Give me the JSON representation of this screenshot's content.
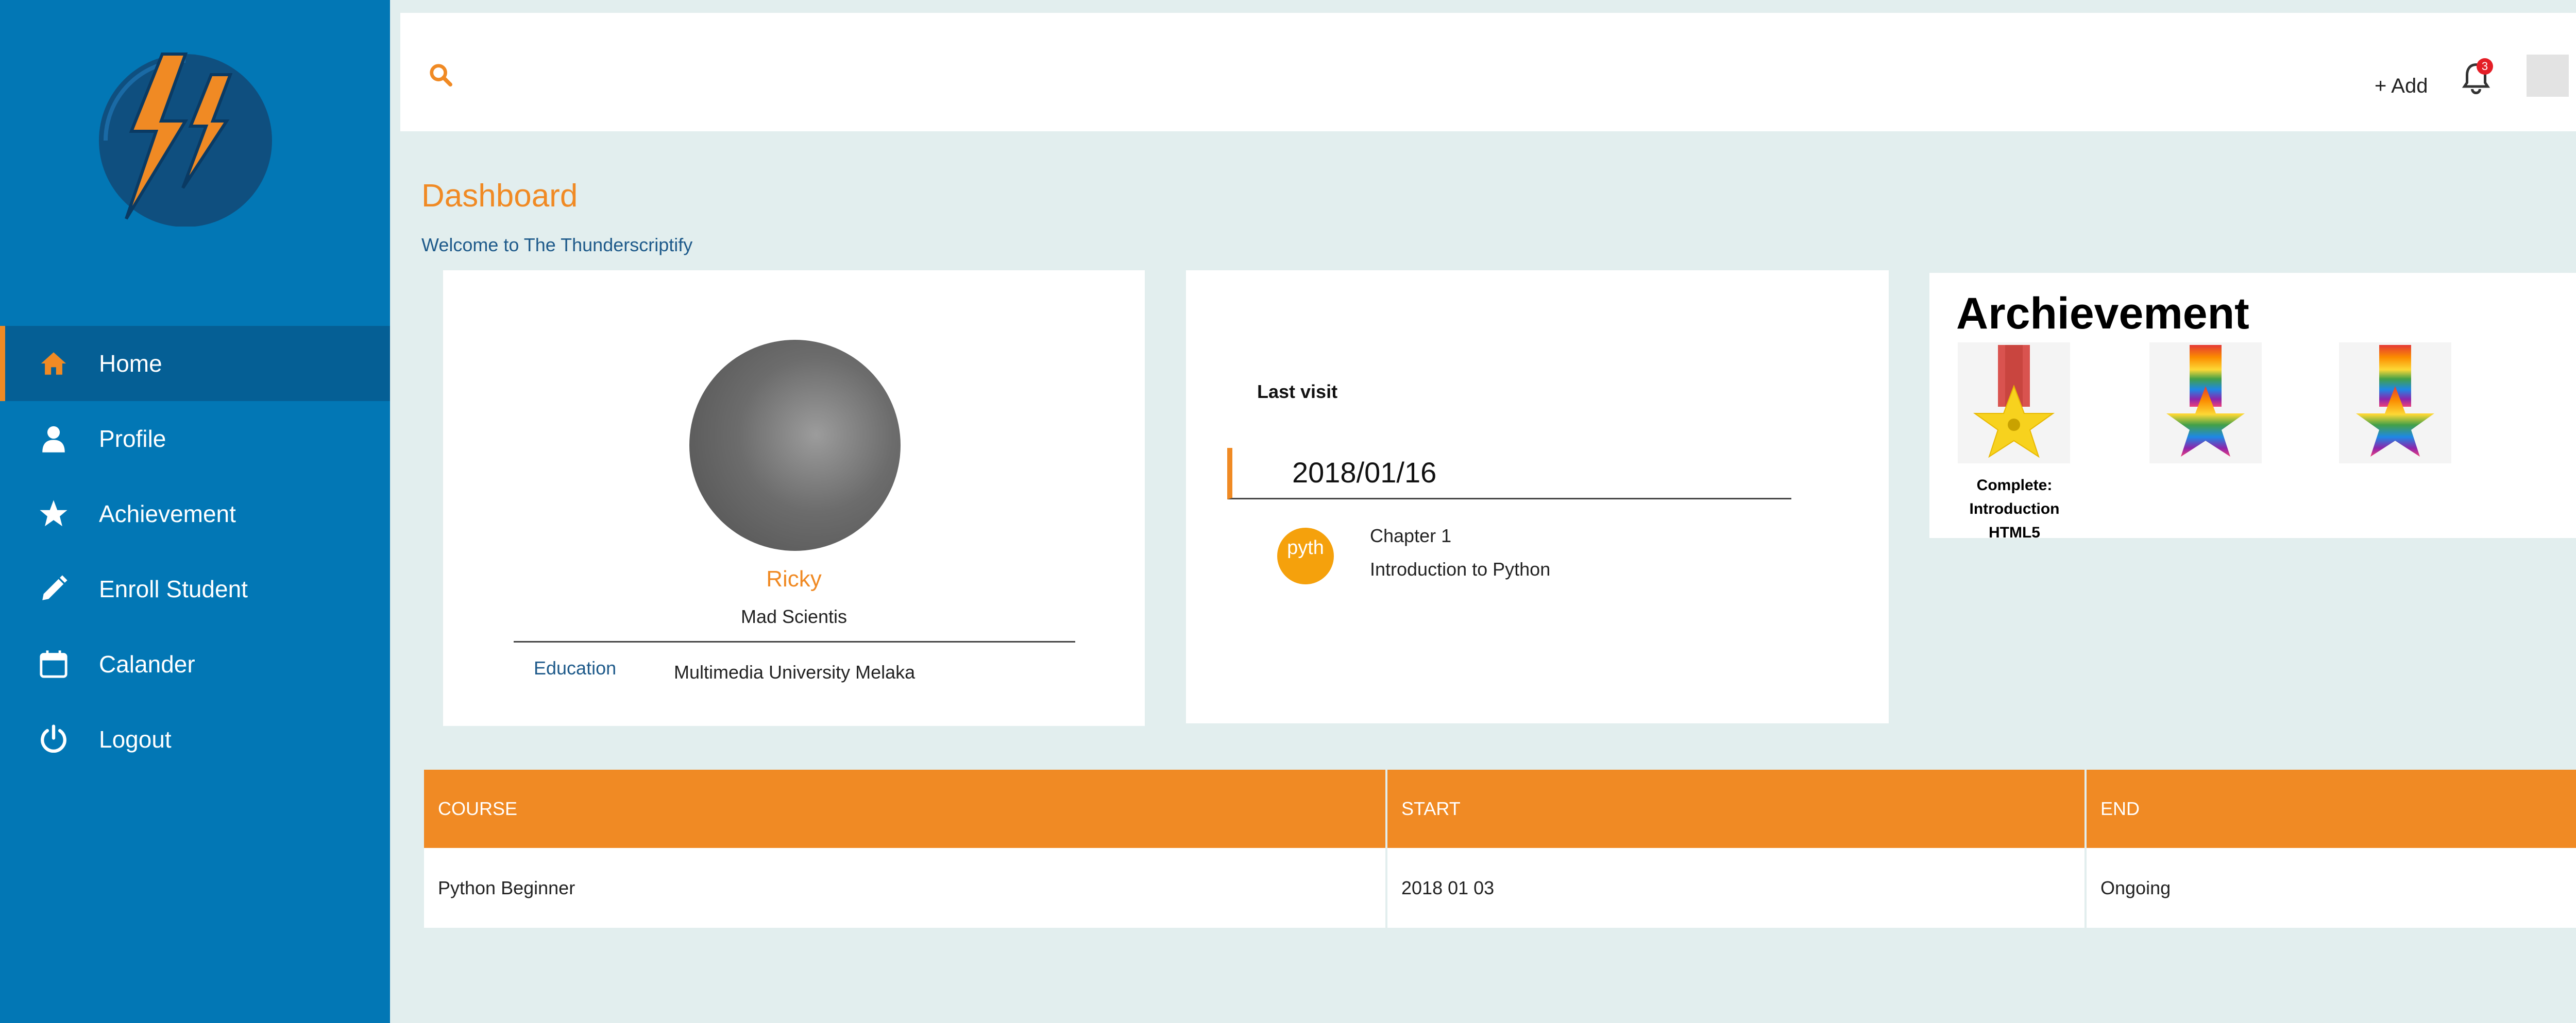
{
  "sidebar": {
    "items": [
      {
        "label": "Home",
        "icon": "home-icon",
        "active": true
      },
      {
        "label": "Profile",
        "icon": "user-icon",
        "active": false
      },
      {
        "label": "Achievement",
        "icon": "star-icon",
        "active": false
      },
      {
        "label": "Enroll Student",
        "icon": "pencil-icon",
        "active": false
      },
      {
        "label": "Calander",
        "icon": "calendar-icon",
        "active": false
      },
      {
        "label": "Logout",
        "icon": "power-icon",
        "active": false
      }
    ]
  },
  "topbar": {
    "add_label": "+ Add",
    "notification_count": "3"
  },
  "page": {
    "title": "Dashboard",
    "welcome": "Welcome to The Thunderscriptify"
  },
  "profile": {
    "name": "Ricky",
    "role": "Mad Scientis",
    "education_label": "Education",
    "education_value": "Multimedia University Melaka"
  },
  "last_visit": {
    "label": "Last visit",
    "date": "2018/01/16",
    "badge": "pyth",
    "chapter": "Chapter 1",
    "chapter_title": "Introduction to Python"
  },
  "achievement": {
    "title": "Archievement",
    "medal_label_line1": "Complete:",
    "medal_label_line2": "Introduction HTML5"
  },
  "table": {
    "headers": [
      "COURSE",
      "START",
      "END"
    ],
    "rows": [
      [
        "Python Beginner",
        "2018 01 03",
        "Ongoing"
      ]
    ]
  },
  "colors": {
    "sidebar": "#0277b5",
    "accent": "#f08a24",
    "background": "#e2eeee"
  }
}
